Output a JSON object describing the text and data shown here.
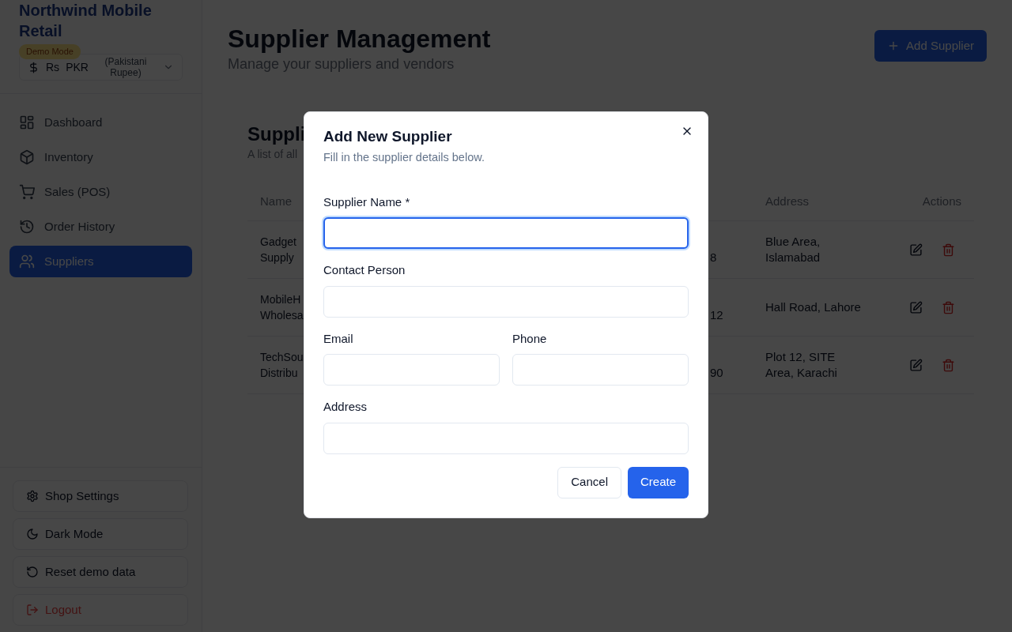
{
  "sidebar": {
    "brand": "Northwind Mobile Retail",
    "badge": "Demo Mode",
    "currency": {
      "symbol": "Rs",
      "code": "PKR",
      "name": "(Pakistani Rupee)"
    },
    "nav": [
      {
        "label": "Dashboard",
        "selected": false
      },
      {
        "label": "Inventory",
        "selected": false
      },
      {
        "label": "Sales (POS)",
        "selected": false
      },
      {
        "label": "Order History",
        "selected": false
      },
      {
        "label": "Suppliers",
        "selected": true
      }
    ],
    "footer_buttons": [
      {
        "label": "Shop Settings",
        "kind": "normal"
      },
      {
        "label": "Dark Mode",
        "kind": "normal"
      },
      {
        "label": "Reset demo data",
        "kind": "normal"
      },
      {
        "label": "Logout",
        "kind": "danger"
      }
    ]
  },
  "header": {
    "title": "Supplier Management",
    "subtitle": "Manage your suppliers and vendors",
    "add_button": "Add Supplier"
  },
  "card": {
    "title": "Suppli",
    "subtitle": "A list of all",
    "columns": {
      "name": "Name",
      "address": "Address",
      "actions": "Actions"
    },
    "rows": [
      {
        "name_lines": [
          "Gadget",
          "Supply"
        ],
        "column_3": "8",
        "address": "Blue Area, Islamabad"
      },
      {
        "name_lines": [
          "MobileH",
          "Wholesa"
        ],
        "column_3": "12",
        "address": "Hall Road, Lahore"
      },
      {
        "name_lines": [
          "TechSou",
          "Distribu"
        ],
        "column_3": "90",
        "address": "Plot 12, SITE Area, Karachi"
      }
    ]
  },
  "dialog": {
    "title": "Add New Supplier",
    "subtitle": "Fill in the supplier details below.",
    "field_rows": [
      [
        {
          "label": "Supplier Name *",
          "focused": true
        }
      ],
      [
        {
          "label": "Contact Person",
          "focused": false
        }
      ],
      [
        {
          "label": "Email",
          "focused": false
        },
        {
          "label": "Phone",
          "focused": false
        }
      ],
      [
        {
          "label": "Address",
          "focused": false
        }
      ]
    ],
    "buttons": [
      {
        "label": "Cancel",
        "kind": "outline"
      },
      {
        "label": "Create",
        "kind": "primary"
      }
    ]
  }
}
